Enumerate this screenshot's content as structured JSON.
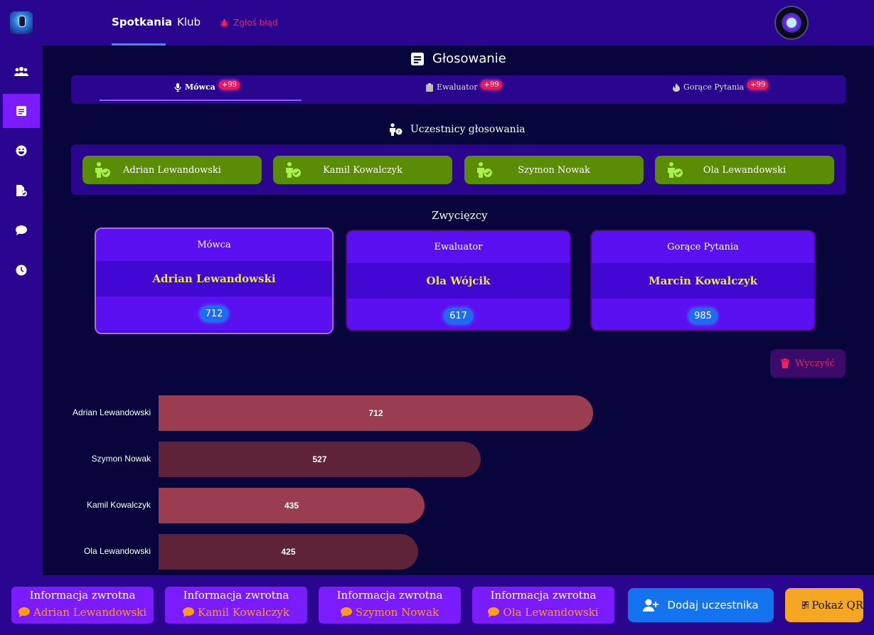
{
  "header": {
    "nav": [
      "Spotkania",
      "Klub"
    ],
    "bug_report": "Zgłoś błąd"
  },
  "sidebar": {
    "items": [
      "users-icon",
      "notes-icon",
      "smile-icon",
      "file-check-icon",
      "chat-icon",
      "clock-icon"
    ],
    "active_index": 1
  },
  "page": {
    "title": "Głosowanie",
    "tabs": [
      {
        "label": "Mówca",
        "badge": "+99",
        "active": true
      },
      {
        "label": "Ewaluator",
        "badge": "+99",
        "active": false
      },
      {
        "label": "Gorące Pytania",
        "badge": "+99",
        "active": false
      }
    ]
  },
  "participants": {
    "title": "Uczestnicy głosowania",
    "names": [
      "Adrian Lewandowski",
      "Kamil Kowalczyk",
      "Szymon Nowak",
      "Ola Lewandowski"
    ]
  },
  "winners": {
    "title": "Zwycięzcy",
    "cards": [
      {
        "role": "Mówca",
        "name": "Adrian Lewandowski",
        "score": "712"
      },
      {
        "role": "Ewaluator",
        "name": "Ola Wójcik",
        "score": "617"
      },
      {
        "role": "Gorące Pytania",
        "name": "Marcin Kowalczyk",
        "score": "985"
      }
    ]
  },
  "clear_label": "Wyczyść",
  "chart_data": {
    "type": "bar",
    "orientation": "horizontal",
    "categories": [
      "Adrian Lewandowski",
      "Szymon Nowak",
      "Kamil Kowalczyk",
      "Ola Lewandowski"
    ],
    "values": [
      712,
      527,
      435,
      425
    ],
    "colors": [
      "#9a3d50",
      "#5e2338",
      "#9a3d50",
      "#5e2338"
    ],
    "xlim": [
      0,
      1000
    ]
  },
  "feedback": {
    "title": "Informacja zwrotna",
    "names": [
      "Adrian Lewandowski",
      "Kamil Kowalczyk",
      "Szymon Nowak",
      "Ola Lewandowski"
    ]
  },
  "actions": {
    "add_participant": "Dodaj uczestnika",
    "show_qr": "Pokaż QR"
  }
}
